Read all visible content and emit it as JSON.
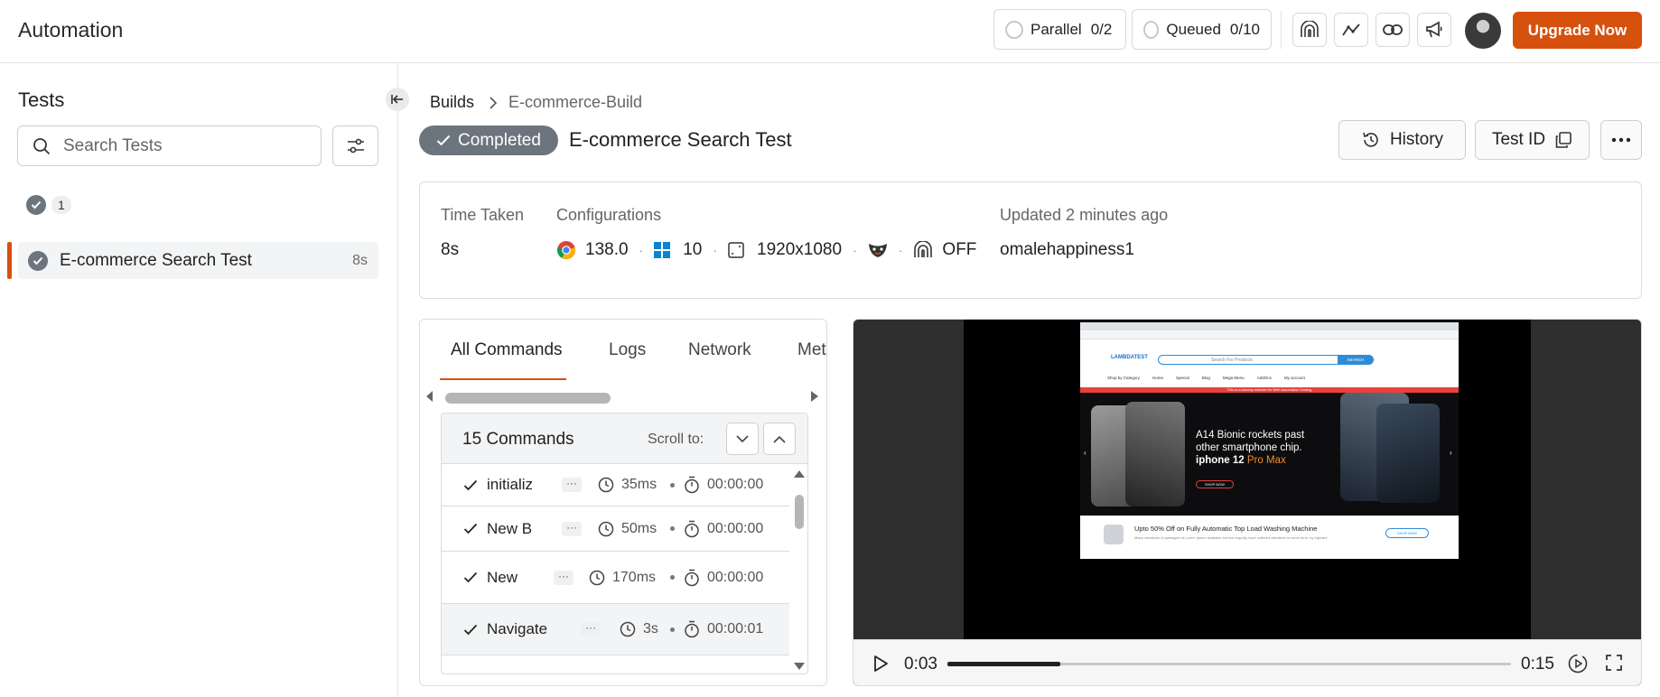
{
  "header": {
    "app_title": "Automation",
    "parallel": {
      "label": "Parallel",
      "value": "0/2"
    },
    "queued": {
      "label": "Queued",
      "value": "0/10"
    },
    "icons": [
      "tunnel-icon",
      "analytics-icon",
      "link-icon",
      "announcement-icon"
    ],
    "upgrade_label": "Upgrade Now",
    "accent_color": "#d6500e"
  },
  "sidebar": {
    "heading": "Tests",
    "search_placeholder": "Search Tests",
    "status_count": "1",
    "tests": [
      {
        "name": "E-commerce Search Test",
        "duration": "8s",
        "status": "passed"
      }
    ]
  },
  "breadcrumb": {
    "root": "Builds",
    "current": "E-commerce-Build"
  },
  "test": {
    "status": "Completed",
    "title": "E-commerce Search Test",
    "history_label": "History",
    "testid_label": "Test ID"
  },
  "info": {
    "time_taken_label": "Time Taken",
    "time_taken": "8s",
    "configurations_label": "Configurations",
    "browser_version": "138.0",
    "os_version": "10",
    "resolution": "1920x1080",
    "tunnel_state": "OFF",
    "updated": "Updated 2 minutes ago",
    "user": "omalehappiness1"
  },
  "commands": {
    "tabs": [
      "All Commands",
      "Logs",
      "Network",
      "Met"
    ],
    "active_tab": "All Commands",
    "count_label": "15 Commands",
    "scroll_to_label": "Scroll to:",
    "rows": [
      {
        "name": "initializ",
        "duration": "35ms",
        "timestamp": "00:00:00"
      },
      {
        "name": "New B",
        "duration": "50ms",
        "timestamp": "00:00:00"
      },
      {
        "name": "New",
        "duration": "170ms",
        "timestamp": "00:00:00"
      },
      {
        "name": "Navigate",
        "duration": "3s",
        "timestamp": "00:00:01"
      }
    ]
  },
  "video": {
    "current_time": "0:03",
    "duration": "0:15",
    "progress": 0.2,
    "page": {
      "logo": "LAMBDATEST",
      "search_placeholder": "Search For Products",
      "search_button": "SEARCH",
      "nav": [
        "Shop by Category",
        "Home",
        "Special",
        "Blog",
        "Mega Menu",
        "AddOns",
        "My account"
      ],
      "banner_notice": "This is a dummy website for Web Automation Testing",
      "hero_line1": "A14 Bionic rockets past",
      "hero_line2": "other smartphone chip.",
      "hero_model": "iphone 12",
      "hero_variant": "Pro Max",
      "hero_cta": "SHOP NOW",
      "promo_title": "Upto 50% Off on Fully Automatic Top Load Washing Machine",
      "promo_text": "Many variations of passages of Lorem Ipsum available but the majority have suffered alteration in some form, by injected.",
      "promo_cta": "SHOP NOW"
    }
  }
}
